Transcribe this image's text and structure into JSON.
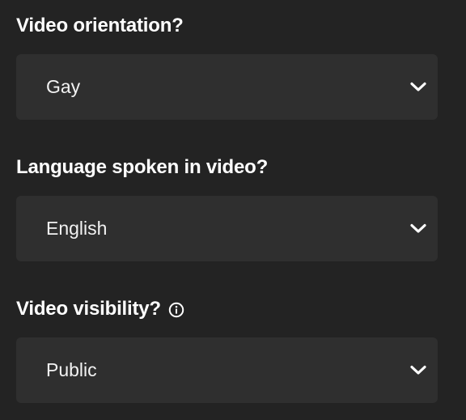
{
  "fields": [
    {
      "label": "Video orientation?",
      "value": "Gay",
      "has_info_icon": false
    },
    {
      "label": "Language spoken in video?",
      "value": "English",
      "has_info_icon": false
    },
    {
      "label": "Video visibility?",
      "value": "Public",
      "has_info_icon": true
    }
  ],
  "icons": {
    "dropdown": "chevron-down-icon",
    "info": "info-icon"
  },
  "colors": {
    "background": "#232323",
    "select_background": "#2f2f2f",
    "text": "#ffffff"
  }
}
